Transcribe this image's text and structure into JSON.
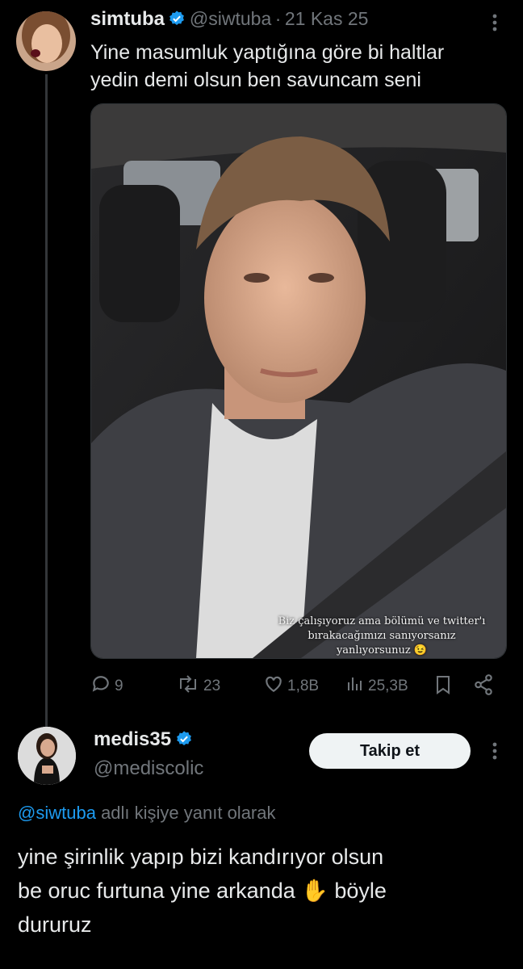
{
  "tweet": {
    "display_name": "simtuba",
    "handle": "@siwtuba",
    "separator": "·",
    "date": "21 Kas 25",
    "text_line1": "Yine masumluk yaptığına göre bi haltlar",
    "text_line2": "yedin demi olsun ben savuncam seni",
    "media_caption_line1": "Biz çalışıyoruz ama bölümü ve twitter'ı",
    "media_caption_line2": "bırakacağımızı sanıyorsanız",
    "media_caption_line3": "yanlıyorsunuz 😉",
    "stats": {
      "replies": "9",
      "reposts": "23",
      "likes": "1,8B",
      "views": "25,3B"
    }
  },
  "reply": {
    "display_name": "medis35",
    "handle": "@mediscolic",
    "follow_label": "Takip et",
    "reply_to_handle": "@siwtuba",
    "reply_to_suffix": "adlı kişiye yanıt olarak",
    "text_line1": "yine şirinlik yapıp bizi kandırıyor olsun",
    "text_line2": "be oruc furtuna yine arkanda ✋ böyle",
    "text_line3": "dururuz"
  },
  "colors": {
    "background": "#000000",
    "text": "#e7e9ea",
    "muted": "#71767b",
    "accent": "#1d9bf0"
  },
  "icons": [
    "verified-badge-icon",
    "more-icon",
    "reply-icon",
    "repost-icon",
    "like-icon",
    "views-icon",
    "bookmark-icon",
    "share-icon"
  ]
}
